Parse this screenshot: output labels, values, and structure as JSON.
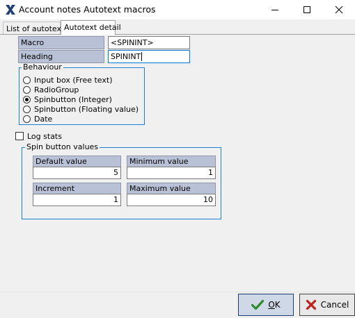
{
  "window": {
    "title": "Account notes Autotext macros",
    "minimize_icon": "minimize-icon",
    "maximize_icon": "maximize-icon",
    "close_icon": "close-icon"
  },
  "tabs": [
    {
      "label": "List of autotexts",
      "active": false
    },
    {
      "label": "Autotext detail",
      "active": true
    }
  ],
  "form": {
    "macro_label": "Macro",
    "macro_value": "<SPININT>",
    "heading_label": "Heading",
    "heading_value": "SPININT"
  },
  "behaviour": {
    "title": "Behaviour",
    "options": [
      {
        "label": "Input box (Free text)",
        "checked": false
      },
      {
        "label": "RadioGroup",
        "checked": false
      },
      {
        "label": "Spinbutton (Integer)",
        "checked": true
      },
      {
        "label": "Spinbutton (Floating value)",
        "checked": false
      },
      {
        "label": "Date",
        "checked": false
      }
    ]
  },
  "log_stats": {
    "label": "Log stats",
    "checked": false
  },
  "spin": {
    "title": "Spin button values",
    "default_label": "Default value",
    "default_value": "5",
    "minimum_label": "Minimum value",
    "minimum_value": "1",
    "increment_label": "Increment",
    "increment_value": "1",
    "maximum_label": "Maximum value",
    "maximum_value": "10"
  },
  "buttons": {
    "ok_prefix": "",
    "ok_accel": "O",
    "ok_rest": "K",
    "cancel_label": "Cancel"
  },
  "colors": {
    "label_bg": "#b9c1d6",
    "group_border": "#1c7ed6",
    "ok_check": "#2e8b2e",
    "cancel_x": "#c0201e"
  }
}
